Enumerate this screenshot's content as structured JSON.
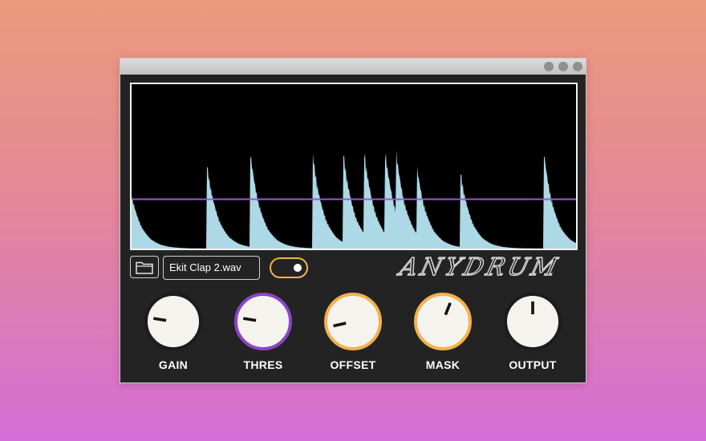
{
  "window": {
    "controls": [
      "window-dot",
      "window-dot",
      "window-dot"
    ]
  },
  "scope": {
    "background": "#000000",
    "waveform_color": "#add8e6",
    "threshold_color": "#9b59d0",
    "threshold_level": 0.3
  },
  "file": {
    "name": "Ekit Clap 2.wav",
    "folder_icon": "folder-icon"
  },
  "toggle": {
    "state": "on",
    "accent": "#f2b24c"
  },
  "logo": {
    "text": "ANYDRUM"
  },
  "knobs": [
    {
      "label": "GAIN",
      "ring_color": "#1c1c1c",
      "value": 0.2
    },
    {
      "label": "THRES",
      "ring_color": "#8a45c4",
      "value": 0.2
    },
    {
      "label": "OFFSET",
      "ring_color": "#f2b24c",
      "value": 0.12
    },
    {
      "label": "MASK",
      "ring_color": "#f2b24c",
      "value": 0.58
    },
    {
      "label": "OUTPUT",
      "ring_color": "#1c1c1c",
      "value": 0.5
    }
  ]
}
